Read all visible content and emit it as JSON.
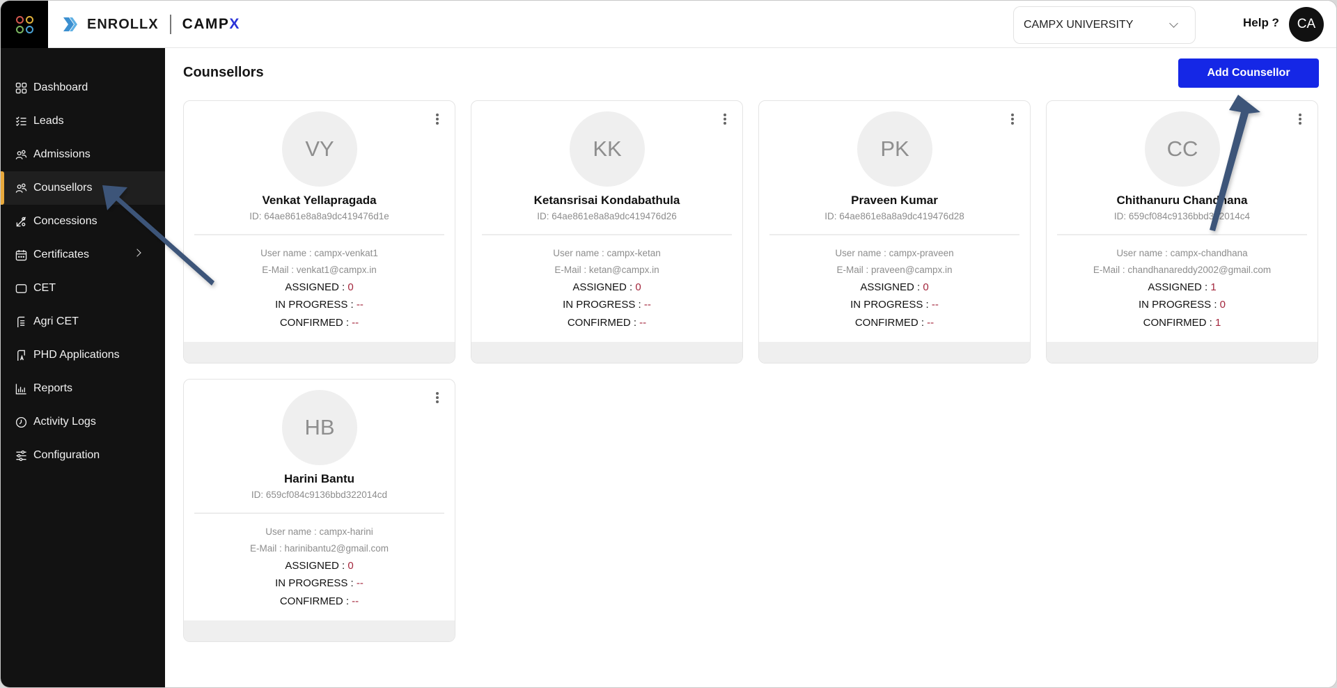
{
  "header": {
    "brand_name": "ENROLLX",
    "brand_partner_prefix": "CAMP",
    "brand_partner_suffix": "X",
    "university_select": {
      "selected": "CAMPX UNIVERSITY"
    },
    "help_label": "Help ?",
    "user_initials": "CA"
  },
  "sidebar": {
    "items": [
      {
        "label": "Dashboard",
        "icon": "dashboard-icon"
      },
      {
        "label": "Leads",
        "icon": "checklist-icon"
      },
      {
        "label": "Admissions",
        "icon": "users-icon"
      },
      {
        "label": "Counsellors",
        "icon": "users-icon",
        "active": true
      },
      {
        "label": "Concessions",
        "icon": "percent-icon"
      },
      {
        "label": "Certificates",
        "icon": "calendar-icon",
        "has_submenu": true
      },
      {
        "label": "CET",
        "icon": "square-icon"
      },
      {
        "label": "Agri CET",
        "icon": "document-icon"
      },
      {
        "label": "PHD Applications",
        "icon": "application-icon"
      },
      {
        "label": "Reports",
        "icon": "bar-chart-icon"
      },
      {
        "label": "Activity Logs",
        "icon": "clock-icon"
      },
      {
        "label": "Configuration",
        "icon": "sliders-icon"
      }
    ],
    "active_accent": "#e8a93c"
  },
  "main": {
    "title": "Counsellors",
    "add_button_label": "Add Counsellor",
    "add_button_color": "#1527e6",
    "labels": {
      "username_prefix": "User name : ",
      "email_prefix": "E-Mail : ",
      "id_prefix": "ID: ",
      "assigned": "ASSIGNED : ",
      "in_progress": "IN PROGRESS : ",
      "confirmed": "CONFIRMED : "
    },
    "counsellors": [
      {
        "initials": "VY",
        "name": "Venkat Yellapragada",
        "id": "ID: 64ae861e8a8a9dc419476d1e",
        "username": "User name : campx-venkat1",
        "email": "E-Mail : venkat1@campx.in",
        "assigned": "0",
        "in_progress": "--",
        "confirmed": "--"
      },
      {
        "initials": "KK",
        "name": "Ketansrisai Kondabathula",
        "id": "ID: 64ae861e8a8a9dc419476d26",
        "username": "User name : campx-ketan",
        "email": "E-Mail : ketan@campx.in",
        "assigned": "0",
        "in_progress": "--",
        "confirmed": "--"
      },
      {
        "initials": "PK",
        "name": "Praveen Kumar",
        "id": "ID: 64ae861e8a8a9dc419476d28",
        "username": "User name : campx-praveen",
        "email": "E-Mail : praveen@campx.in",
        "assigned": "0",
        "in_progress": "--",
        "confirmed": "--"
      },
      {
        "initials": "CC",
        "name": "Chithanuru Chandhana",
        "id": "ID: 659cf084c9136bbd322014c4",
        "username": "User name : campx-chandhana",
        "email": "E-Mail : chandhanareddy2002@gmail.com",
        "assigned": "1",
        "in_progress": "0",
        "confirmed": "1"
      },
      {
        "initials": "HB",
        "name": "Harini Bantu",
        "id": "ID: 659cf084c9136bbd322014cd",
        "username": "User name : campx-harini",
        "email": "E-Mail : harinibantu2@gmail.com",
        "assigned": "0",
        "in_progress": "--",
        "confirmed": "--"
      }
    ],
    "stat_value_color": "#a3263c"
  },
  "annotations": {
    "arrow_color": "#3c5479",
    "arrows": [
      {
        "target": "sidebar-item-counsellors"
      },
      {
        "target": "add-counsellor-button"
      }
    ]
  }
}
